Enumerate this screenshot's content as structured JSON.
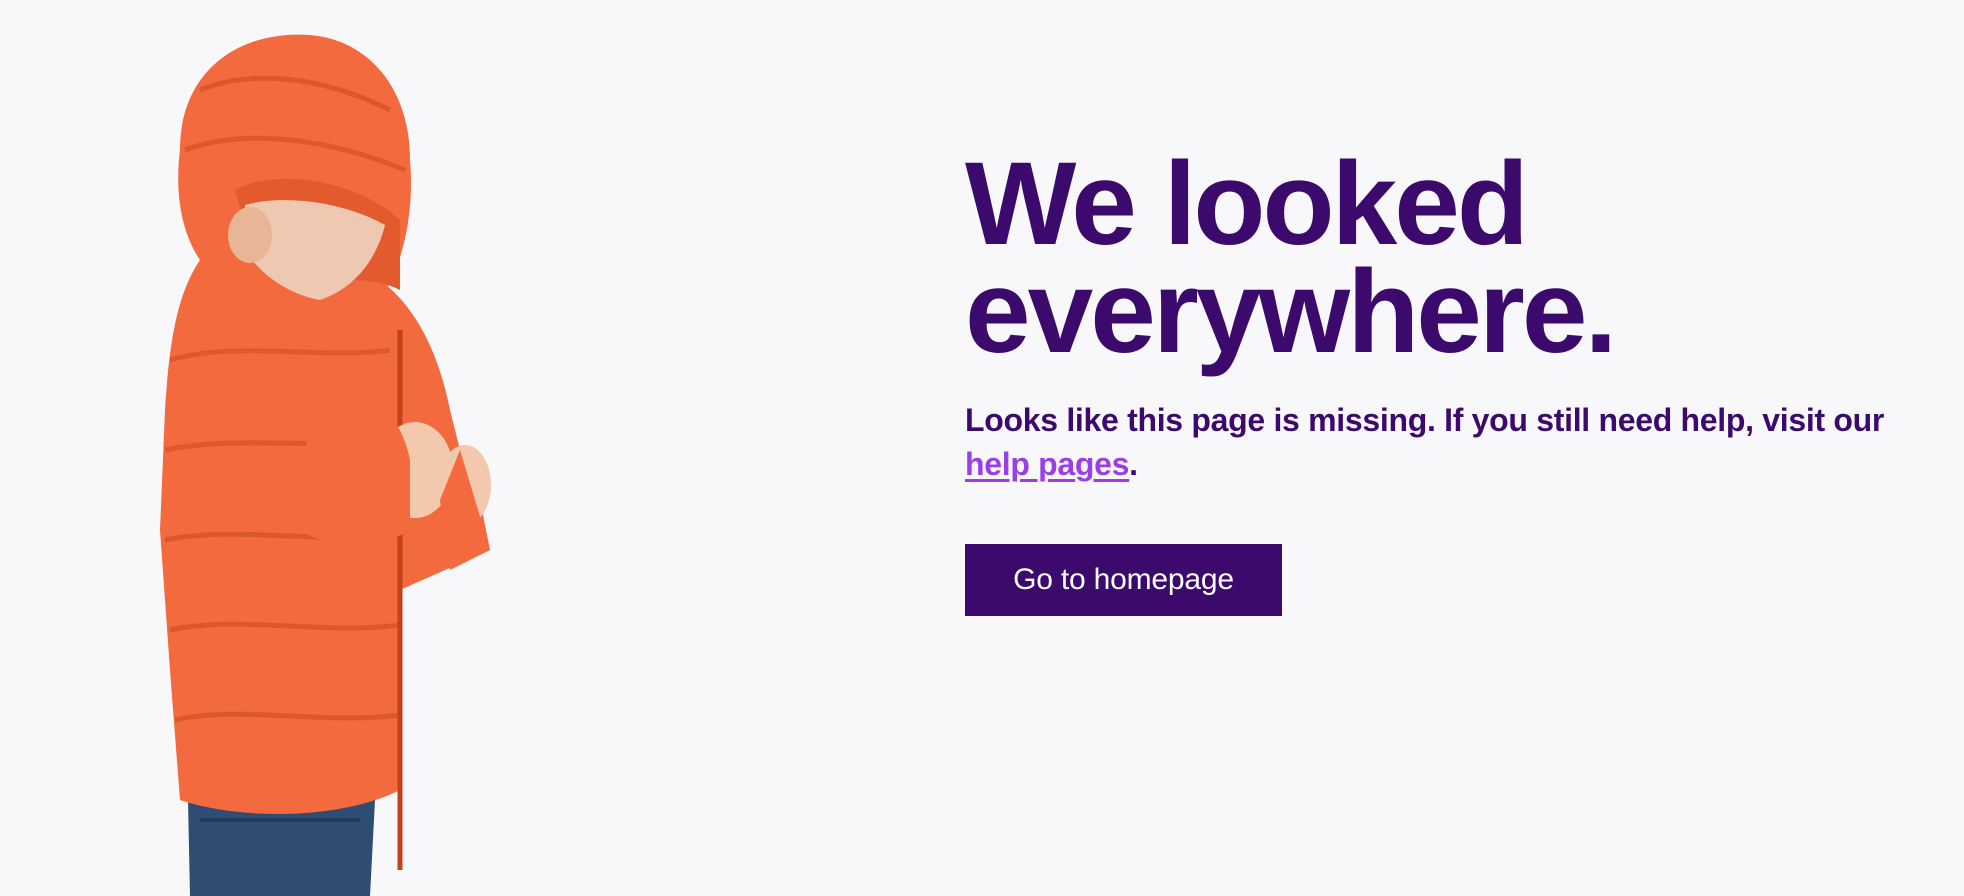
{
  "colors": {
    "background": "#f8f8fa",
    "primary": "#3c096c",
    "link": "#9b3ee8",
    "jacket": "#f26a3d"
  },
  "hero_image": {
    "icon": "child-in-orange-puffer-jacket-illustration"
  },
  "headline": {
    "line1": "We looked",
    "line2": "everywhere."
  },
  "message": {
    "text_before_link": "Looks like this page is missing. If you still need help, visit our ",
    "link_label": "help pages",
    "text_after_link": "."
  },
  "cta": {
    "label": "Go to homepage"
  }
}
